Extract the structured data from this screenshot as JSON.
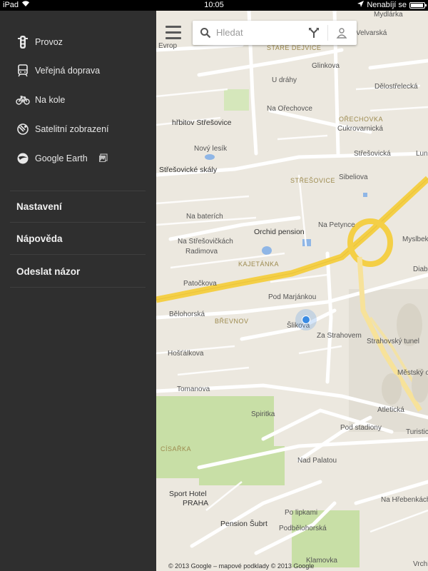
{
  "status_bar": {
    "device": "iPad",
    "time": "10:05",
    "charging_label": "Nenabíjí se"
  },
  "menu": {
    "items": [
      {
        "label": "Provoz",
        "icon": "traffic-light-icon"
      },
      {
        "label": "Veřejná doprava",
        "icon": "train-icon"
      },
      {
        "label": "Na kole",
        "icon": "bicycle-icon"
      },
      {
        "label": "Satelitní zobrazení",
        "icon": "satellite-icon"
      },
      {
        "label": "Google Earth",
        "icon": "globe-icon"
      }
    ],
    "sections": [
      "Nastavení",
      "Nápověda",
      "Odeslat názor"
    ]
  },
  "search": {
    "placeholder": "Hledat"
  },
  "map": {
    "labels": {
      "evrop": "Evrop",
      "velvarska": "Velvarská",
      "mydlarka": "Mydlárka",
      "stare_dejvice": "STARÉ DEJVICE",
      "glinkova": "Glinkova",
      "u_drahy": "U dráhy",
      "delostrelecka": "Dělostřelecká",
      "na_orechovce": "Na Ořechovce",
      "orechovka": "OŘECHOVKA",
      "cukrovarnicka": "Cukrovarnická",
      "hrbitov": "hřbitov Střešovice",
      "novy_lesik": "Nový lesík",
      "stresovicka": "Střešovická",
      "lun": "Lun",
      "stresovicke_skaly": "Střešovické skály",
      "stresovice": "STŘEŠOVICE",
      "sibeliova": "Sibeliova",
      "na_batenich": "Na baterích",
      "na_stresovickach": "Na Střešovičkách",
      "orchid": "Orchid pension",
      "na_petynce": "Na Petynce",
      "radimova": "Radimova",
      "kajetanka": "KAJETÁNKA",
      "patockova": "Patočkova",
      "myslbekova": "Myslbekova",
      "diab": "Diab",
      "pod_marjankou": "Pod Marjánkou",
      "belohorska": "Bělohorská",
      "brevnov": "BŘEVNOV",
      "silkova": "Šlikova",
      "za_strahovem": "Za Strahovem",
      "strahovsky_tunel": "Strahovský tunel",
      "mestsky": "Městský o",
      "hostalkova": "Hošťálkova",
      "tomanova": "Tomanova",
      "spiritka": "Spiritka",
      "atleticka": "Atletická",
      "pod_stadiony": "Pod stadiony",
      "turisticka": "Turistic",
      "cisarka": "CÍSAŘKA",
      "nad_palatou": "Nad Palatou",
      "sport_hotel": "Sport Hotel",
      "praha": "PRAHA",
      "na_hrebenkach": "Na Hřebenkách",
      "po_lipkami": "Po lipkami",
      "pension_subrt": "Pension Šubrt",
      "podbelohorska": "Podbělohorská",
      "klamovka": "Klamovka",
      "vrchl": "Vrchl"
    },
    "copyright": "© 2013 Google – mapové podklady © 2013 Google"
  },
  "colors": {
    "menu_bg": "#2f2f2f",
    "map_bg": "#ece8df",
    "highway": "#f4cf46",
    "park": "#c8dfa6",
    "water": "#8fb6e6",
    "location": "#3a8be3"
  }
}
